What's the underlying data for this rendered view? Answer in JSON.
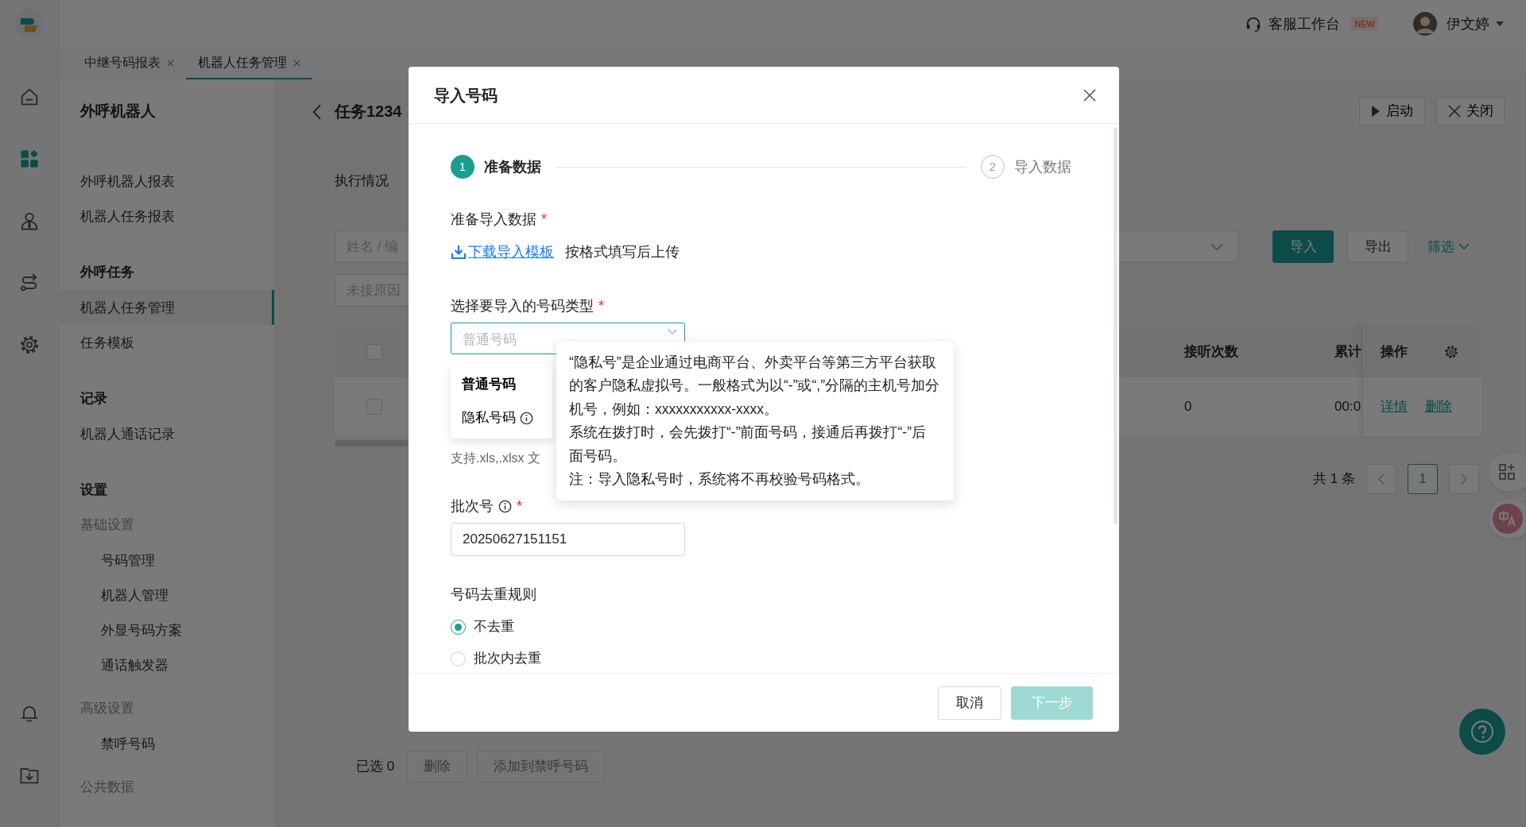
{
  "rail": {
    "top": [
      {
        "kind": "home",
        "selected": false
      },
      {
        "kind": "apps",
        "selected": true
      },
      {
        "kind": "person",
        "selected": false
      },
      {
        "kind": "route",
        "selected": false
      },
      {
        "kind": "settings",
        "selected": false
      }
    ],
    "bottom": [
      {
        "kind": "bell",
        "selected": false
      },
      {
        "kind": "download",
        "selected": false
      }
    ]
  },
  "topbar": {
    "workbench": "客服工作台",
    "badge": "NEW",
    "user": "伊文婷"
  },
  "tabs": [
    {
      "label": "中继号码报表",
      "selected": false
    },
    {
      "label": "机器人任务管理",
      "selected": true
    }
  ],
  "sidebar": {
    "title": "外呼机器人",
    "sections": [
      {
        "items": [
          {
            "kind": "item",
            "label": "外呼机器人报表",
            "selected": false
          },
          {
            "kind": "item",
            "label": "机器人任务报表",
            "selected": false
          }
        ]
      },
      {
        "title": "外呼任务",
        "items": [
          {
            "kind": "item",
            "label": "机器人任务管理",
            "selected": true
          },
          {
            "kind": "item",
            "label": "任务模板",
            "selected": false
          }
        ]
      },
      {
        "title": "记录",
        "items": [
          {
            "kind": "item",
            "label": "机器人通话记录",
            "selected": false
          }
        ]
      },
      {
        "title": "设置",
        "items": [
          {
            "kind": "group",
            "label": "基础设置",
            "children": [
              {
                "kind": "item",
                "label": "号码管理",
                "selected": false
              },
              {
                "kind": "item",
                "label": "机器人管理",
                "selected": false
              },
              {
                "kind": "item",
                "label": "外显号码方案",
                "selected": false
              },
              {
                "kind": "item",
                "label": "通话触发器",
                "selected": false
              }
            ]
          },
          {
            "kind": "group",
            "label": "高级设置",
            "children": [
              {
                "kind": "item",
                "label": "禁呼号码",
                "selected": false
              }
            ]
          },
          {
            "kind": "group",
            "label": "公共数据"
          }
        ]
      }
    ]
  },
  "page": {
    "title": "任务1234",
    "section": "执行情况",
    "search_placeholder": "姓名 / 编",
    "reason_placeholder": "未接原因",
    "actions": [
      {
        "kind": "start",
        "label": "启动"
      },
      {
        "kind": "close",
        "label": "关闭"
      }
    ],
    "toolbar": [
      {
        "kind": "primary",
        "label": "导入"
      },
      {
        "kind": "default",
        "label": "导出"
      },
      {
        "kind": "link",
        "label": "筛选"
      }
    ],
    "table": {
      "header_checked": false,
      "columns": [
        "接听次数",
        "累计",
        "操作"
      ],
      "rows": [
        {
          "checked": false,
          "cells": [
            "0",
            "00:0"
          ],
          "actions": [
            "详情",
            "删除"
          ]
        }
      ]
    },
    "pagination": {
      "total": "共 1 条",
      "pages": [
        {
          "label": "1",
          "selected": true
        }
      ]
    },
    "bottom": {
      "selected_count": "已选 0",
      "buttons": [
        {
          "label": "删除",
          "disabled": true
        },
        {
          "label": "添加到禁呼号码",
          "disabled": true
        }
      ]
    }
  },
  "dialog": {
    "title": "导入号码",
    "steps": [
      {
        "number": "1",
        "label": "准备数据",
        "selected": true
      },
      {
        "number": "2",
        "label": "导入数据",
        "selected": false
      }
    ],
    "fields": [
      {
        "kind": "download",
        "label": "准备导入数据",
        "required_mark": "*",
        "link": "下载导入模板",
        "hint": "按格式填写后上传"
      },
      {
        "kind": "select",
        "label": "选择要导入的号码类型",
        "required_mark": "*",
        "placeholder": "普通号码",
        "expanded": true,
        "options": [
          {
            "label": "普通号码",
            "selected": true,
            "info": false
          },
          {
            "label": "隐私号码",
            "selected": false,
            "info": true
          }
        ],
        "note": "支持.xls,.xlsx 文",
        "tooltip": [
          "“隐私号”是企业通过电商平台、外卖平台等第三方平台获取的客户隐私虚拟号。一般格式为以“-”或“,”分隔的主机号加分机号，例如：xxxxxxxxxxx-xxxx。",
          "系统在拨打时，会先拨打“-”前面号码，接通后再拨打“-”后面号码。",
          "注：导入隐私号时，系统将不再校验号码格式。"
        ]
      },
      {
        "kind": "input",
        "label": "批次号",
        "required_mark": "*",
        "info": true,
        "value": "20250627151151"
      },
      {
        "kind": "radio",
        "label": "号码去重规则",
        "options": [
          {
            "label": "不去重",
            "selected": true
          },
          {
            "label": "批次内去重",
            "selected": false
          }
        ]
      }
    ],
    "buttons": [
      {
        "kind": "secondary",
        "label": "取消",
        "disabled": false
      },
      {
        "kind": "primary",
        "label": "下一步",
        "disabled": true
      }
    ]
  }
}
